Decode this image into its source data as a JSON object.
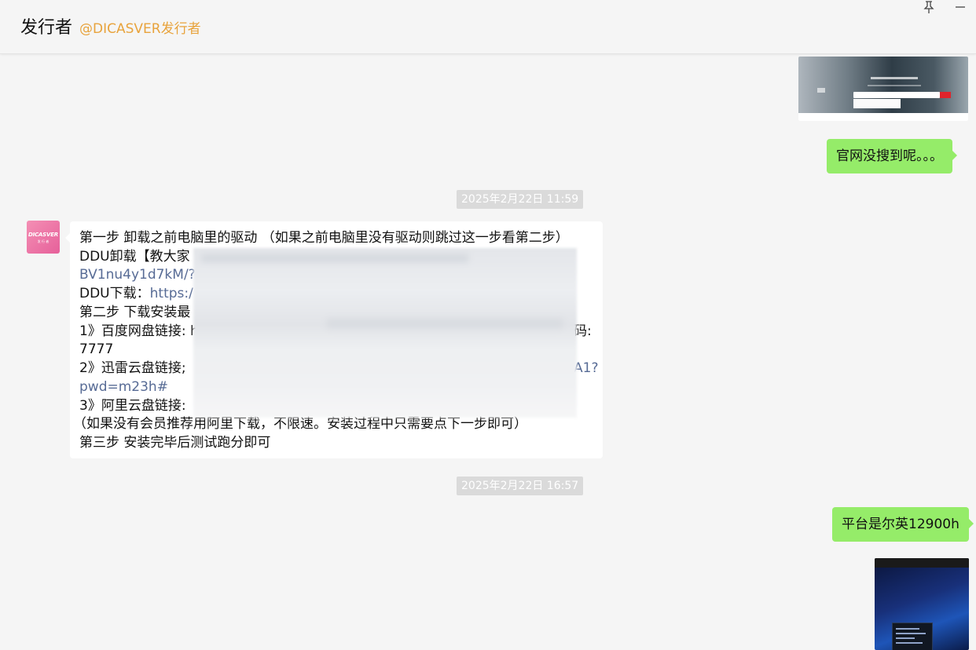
{
  "header": {
    "title": "发行者",
    "handle": "@DICASVER发行者",
    "pin_icon": "pin-icon",
    "minimize_icon": "minimize-icon"
  },
  "messages": {
    "msg1_text": "官网没搜到呢。。。",
    "time1": "2025年2月22日 11:59",
    "avatar_text": "DICASVER",
    "avatar_sub": "发 行 者",
    "reply_lines": [
      "第一步 卸载之前电脑里的驱动 （如果之前电脑里没有驱动则跳过这一步看第二步）",
      "DDU卸载【教大家",
      "BV1nu4y1d7kM/?",
      "DDU下载：",
      "https:/",
      "第二步 下载安装最",
      "1》百度网盘链接: h",
      "码:",
      "7777",
      "2》迅雷云盘链接;",
      "A1?",
      "pwd=m23h#",
      "3》阿里云盘链接:",
      "（如果没有会员推荐用阿里下载，不限速。安装过程中只需要点下一步即可）",
      "第三步 安装完毕后测试跑分即可"
    ],
    "time2": "2025年2月22日 16:57",
    "msg2_text": "平台是尔英12900h"
  },
  "colors": {
    "accent_handle": "#e8a33c",
    "bubble_self": "#95ec69",
    "link": "#576b95",
    "background": "#f5f5f5"
  }
}
